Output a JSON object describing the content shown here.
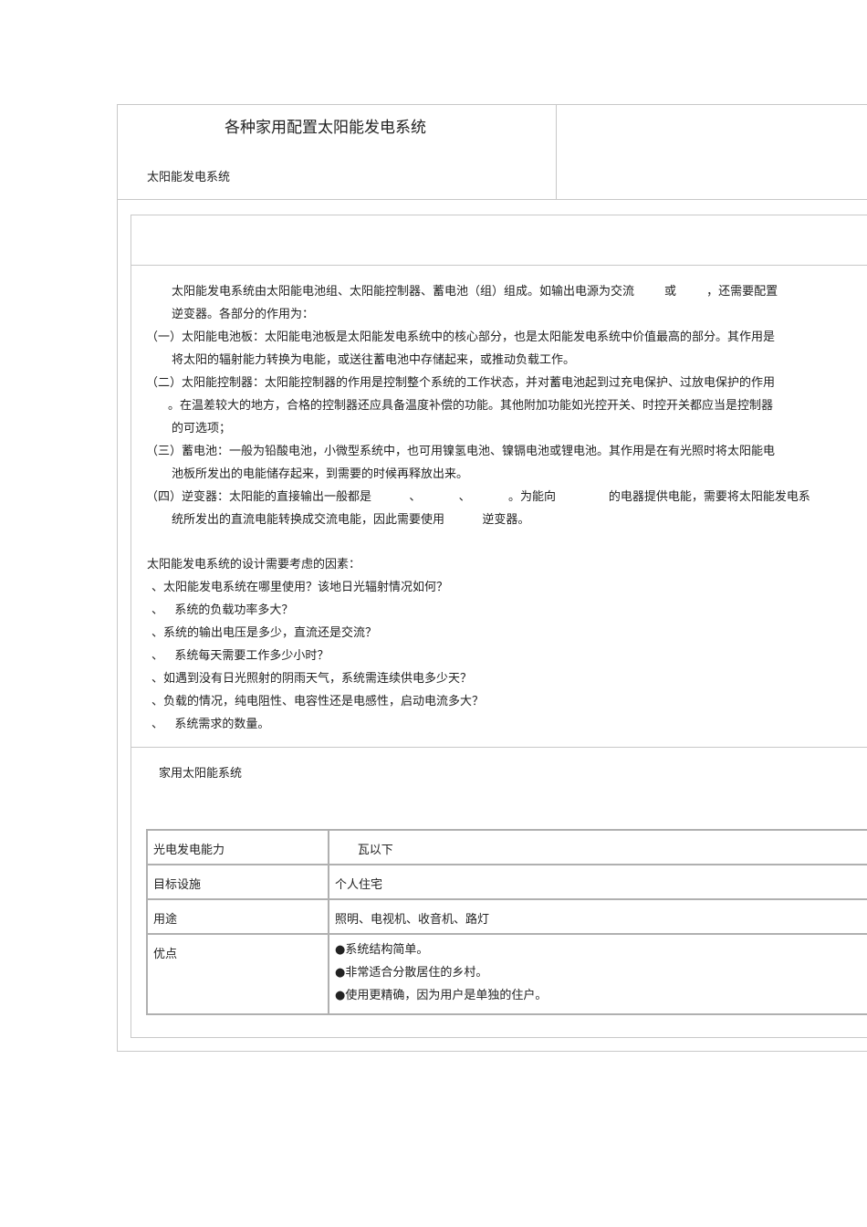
{
  "header": {
    "title": "各种家用配置太阳能发电系统",
    "subtitle": "太阳能发电系统"
  },
  "intro": {
    "lines": [
      "太阳能发电系统由太阳能电池组、太阳能控制器、蓄电池（组）组成。如输出电源为交流        或        ，还需要配置",
      "逆变器。各部分的作用为：",
      "（一）太阳能电池板：太阳能电池板是太阳能发电系统中的核心部分，也是太阳能发电系统中价值最高的部分。其作用是",
      "将太阳的辐射能力转换为电能，或送往蓄电池中存储起来，或推动负载工作。",
      "（二）太阳能控制器：太阳能控制器的作用是控制整个系统的工作状态，并对蓄电池起到过充电保护、过放电保护的作用",
      "。在温差较大的地方，合格的控制器还应具备温度补偿的功能。其他附加功能如光控开关、时控开关都应当是控制器",
      "的可选项；",
      "（三）蓄电池：一般为铅酸电池，小微型系统中，也可用镍氢电池、镍镉电池或锂电池。其作用是在有光照时将太阳能电",
      "池板所发出的电能储存起来，到需要的时候再释放出来。",
      "（四）逆变器：太阳能的直接输出一般都是          、          、          。为能向              的电器提供电能，需要将太阳能发电系",
      "统所发出的直流电能转换成交流电能，因此需要使用          逆变器。"
    ]
  },
  "design": {
    "heading": "太阳能发电系统的设计需要考虑的因素：",
    "items": [
      "、太阳能发电系统在哪里使用？该地日光辐射情况如何？",
      "、   系统的负载功率多大？",
      "、系统的输出电压是多少，直流还是交流？",
      "、   系统每天需要工作多少小时？",
      "、如遇到没有日光照射的阴雨天气，系统需连续供电多少天？",
      "、负载的情况，纯电阻性、电容性还是电感性，启动电流多大？",
      "、   系统需求的数量。"
    ]
  },
  "home": {
    "heading": "家用太阳能系统",
    "table": [
      {
        "key": "光电发电能力",
        "value": "      瓦以下"
      },
      {
        "key": "目标设施",
        "value": "个人住宅"
      },
      {
        "key": "用途",
        "value": "照明、电视机、收音机、路灯"
      }
    ],
    "advantages_key": "优点",
    "advantages": [
      "●系统结构简单。",
      "●非常适合分散居住的乡村。",
      "●使用更精确，因为用户是单独的住户。"
    ]
  }
}
